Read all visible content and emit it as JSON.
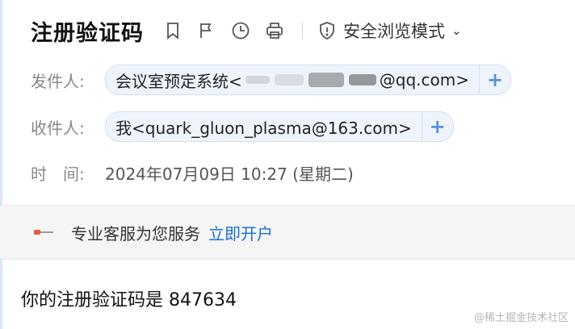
{
  "header": {
    "subject": "注册验证码",
    "safe_mode_label": "安全浏览模式"
  },
  "sender": {
    "label": "发件人:",
    "name": "会议室预定系统<",
    "email_suffix": "@qq.com>"
  },
  "recipient": {
    "label": "收件人:",
    "address": "我<quark_gluon_plasma@163.com>"
  },
  "time": {
    "label": "时　间:",
    "value": "2024年07月09日 10:27 (星期二)"
  },
  "banner": {
    "text": "专业客服为您服务",
    "link": "立即开户"
  },
  "body": {
    "text": "你的注册验证码是 847634"
  },
  "watermark": "@稀土掘金技术社区",
  "colors": {
    "accent": "#1a6fd6",
    "chip_bg": "#eef4fc",
    "banner_bg": "#f5f5f6"
  },
  "icons": [
    "bookmark-icon",
    "flag-icon",
    "clock-icon",
    "printer-icon",
    "shield-icon",
    "chevron-down-icon",
    "add-contact-icon",
    "service-icon"
  ]
}
